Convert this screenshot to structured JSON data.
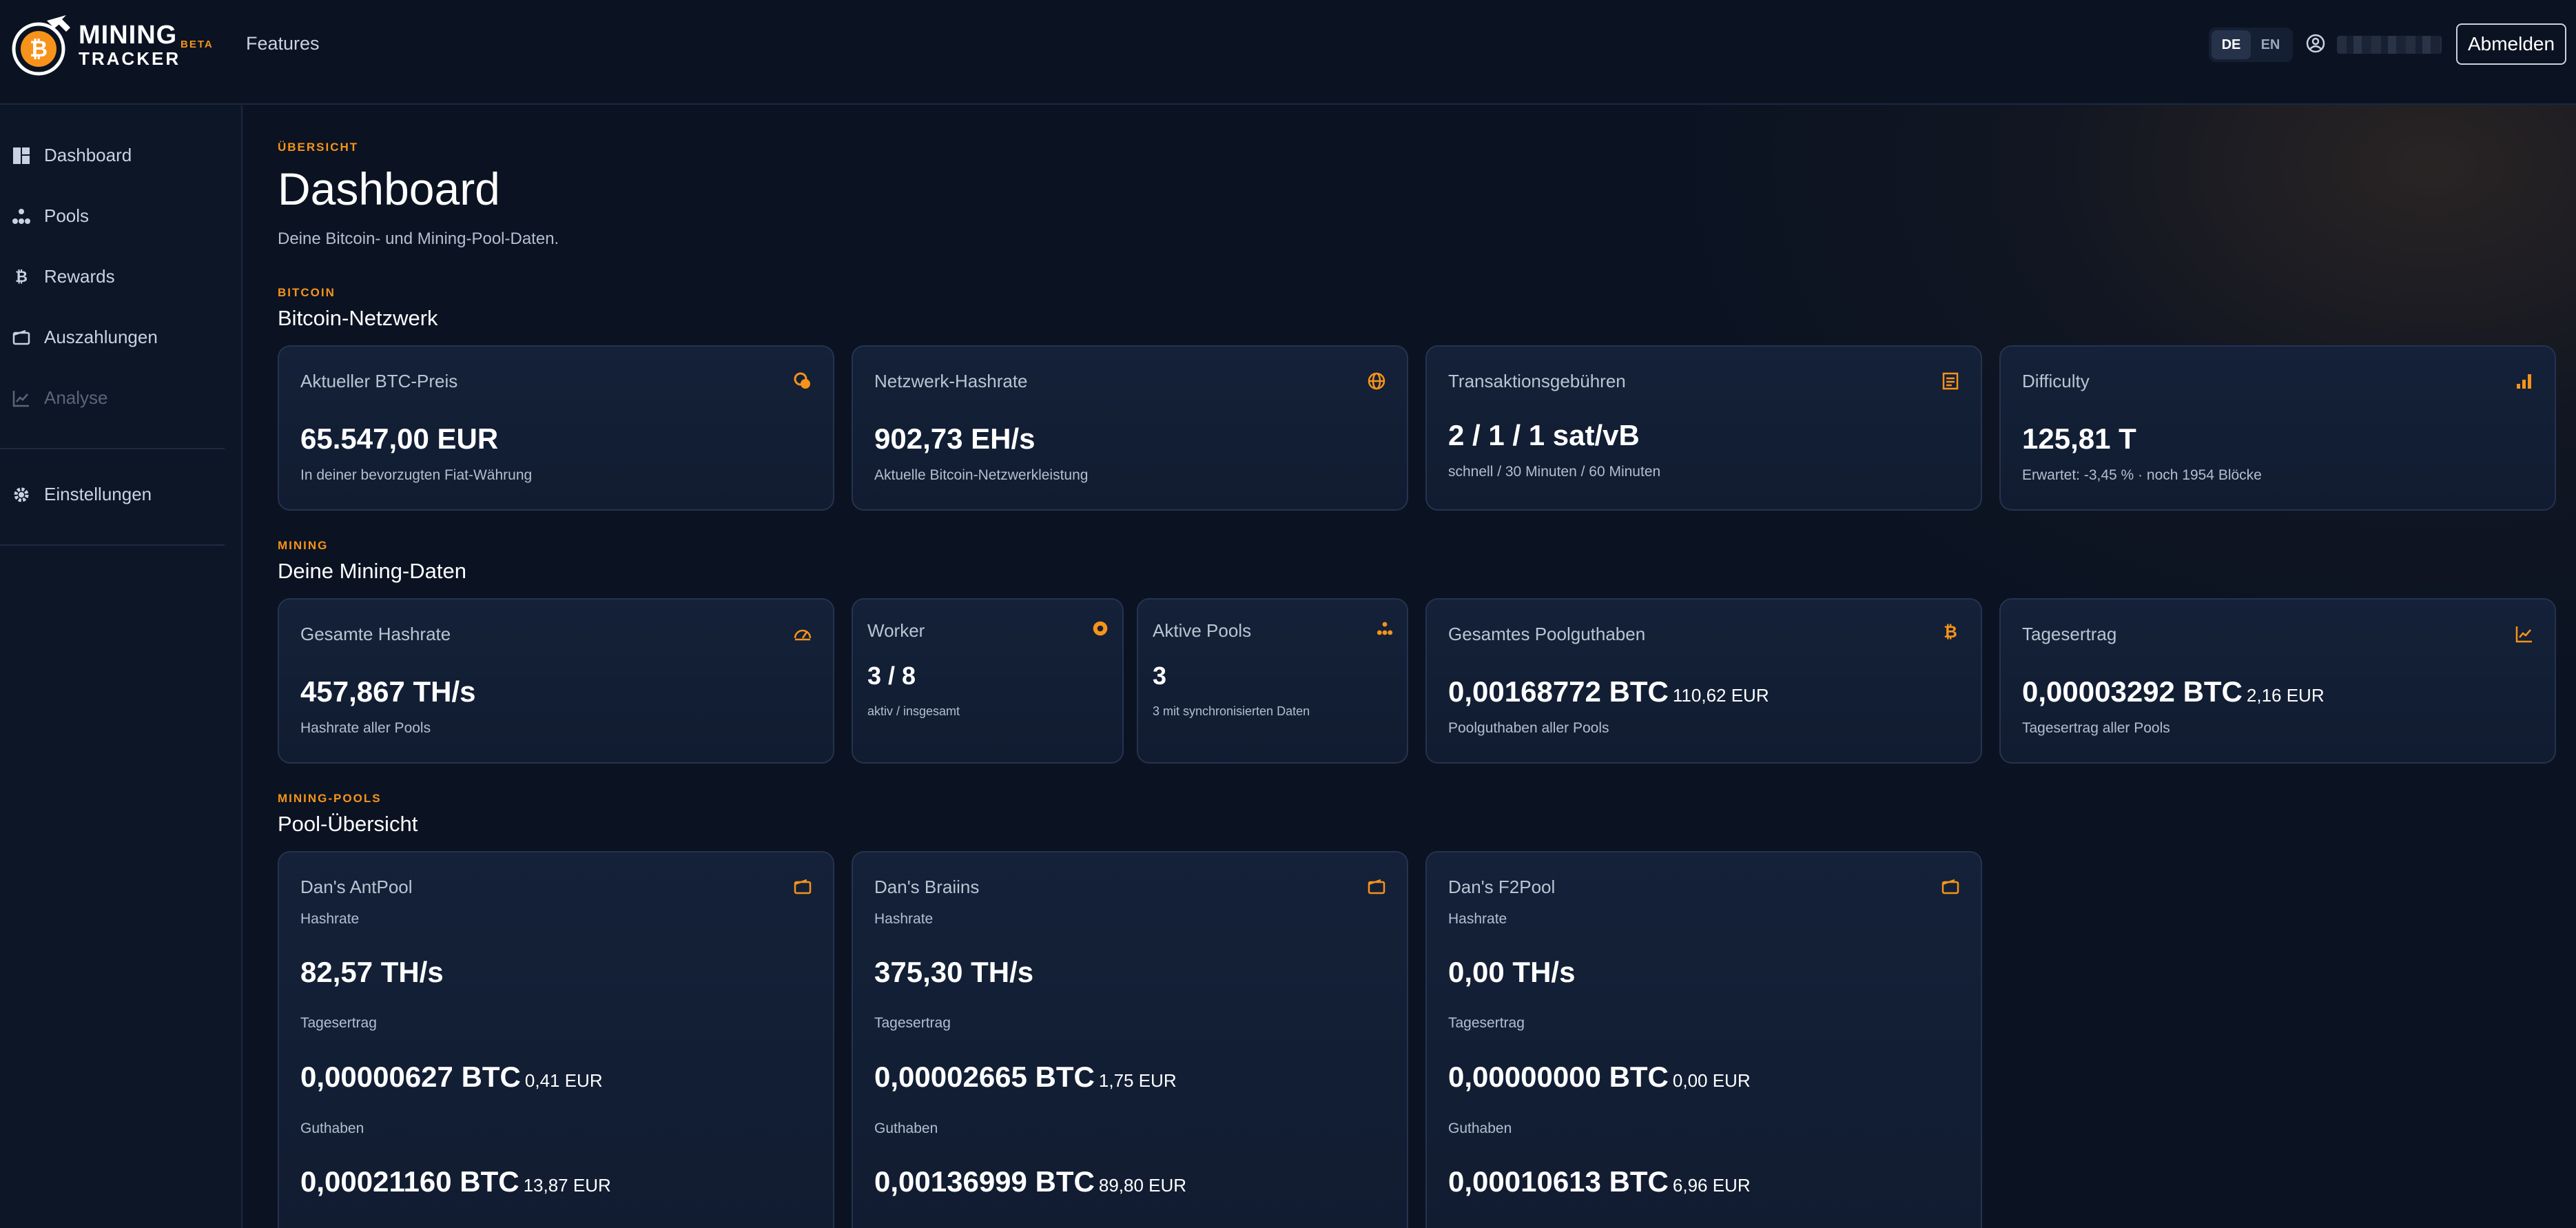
{
  "brand": {
    "line1": "MINING",
    "line2": "TRACKER",
    "beta": "BETA"
  },
  "header": {
    "features": "Features",
    "lang": {
      "de": "DE",
      "en": "EN"
    },
    "logout": "Abmelden"
  },
  "sidebar": {
    "items": [
      {
        "label": "Dashboard",
        "icon": "dashboard-icon"
      },
      {
        "label": "Pools",
        "icon": "pools-icon"
      },
      {
        "label": "Rewards",
        "icon": "bitcoin-icon"
      },
      {
        "label": "Auszahlungen",
        "icon": "wallet-icon"
      },
      {
        "label": "Analyse",
        "icon": "chart-icon"
      },
      {
        "label": "Einstellungen",
        "icon": "gear-icon"
      }
    ]
  },
  "page": {
    "eyebrow": "ÜBERSICHT",
    "title": "Dashboard",
    "subtitle": "Deine Bitcoin- und Mining-Pool-Daten."
  },
  "network": {
    "eyebrow": "BITCOIN",
    "title": "Bitcoin-Netzwerk",
    "cards": [
      {
        "label": "Aktueller BTC-Preis",
        "value": "65.547,00 EUR",
        "note": "In deiner bevorzugten Fiat-Währung"
      },
      {
        "label": "Netzwerk-Hashrate",
        "value": "902,73 EH/s",
        "note": "Aktuelle Bitcoin-Netzwerkleistung"
      },
      {
        "label": "Transaktionsgebühren",
        "value": "2 / 1 / 1 sat/vB",
        "note": "schnell / 30 Minuten / 60 Minuten"
      },
      {
        "label": "Difficulty",
        "value": "125,81 T",
        "note": "Erwartet: -3,45 % · noch 1954 Blöcke"
      }
    ]
  },
  "mining": {
    "eyebrow": "MINING",
    "title": "Deine Mining-Daten",
    "total_hashrate": {
      "label": "Gesamte Hashrate",
      "value": "457,867 TH/s",
      "note": "Hashrate aller Pools"
    },
    "worker": {
      "label": "Worker",
      "value": "3 / 8",
      "note": "aktiv / insgesamt"
    },
    "active_pools": {
      "label": "Aktive Pools",
      "value": "3",
      "note": "3 mit synchronisierten Daten"
    },
    "pool_balance": {
      "label": "Gesamtes Poolguthaben",
      "value": "0,00168772 BTC",
      "sub": "110,62 EUR",
      "note": "Poolguthaben aller Pools"
    },
    "daily_yield": {
      "label": "Tagesertrag",
      "value": "0,00003292 BTC",
      "sub": "2,16 EUR",
      "note": "Tagesertrag aller Pools"
    }
  },
  "pools": {
    "eyebrow": "MINING-POOLS",
    "title": "Pool-Übersicht",
    "hashrate_label": "Hashrate",
    "yield_label": "Tagesertrag",
    "balance_label": "Guthaben",
    "items": [
      {
        "name": "Dan's AntPool",
        "hashrate": "82,57 TH/s",
        "yield": "0,00000627 BTC",
        "yield_eur": "0,41 EUR",
        "balance": "0,00021160 BTC",
        "balance_eur": "13,87 EUR"
      },
      {
        "name": "Dan's Braiins",
        "hashrate": "375,30 TH/s",
        "yield": "0,00002665 BTC",
        "yield_eur": "1,75 EUR",
        "balance": "0,00136999 BTC",
        "balance_eur": "89,80 EUR"
      },
      {
        "name": "Dan's F2Pool",
        "hashrate": "0,00 TH/s",
        "yield": "0,00000000 BTC",
        "yield_eur": "0,00 EUR",
        "balance": "0,00010613 BTC",
        "balance_eur": "6,96 EUR"
      }
    ]
  },
  "colors": {
    "accent": "#f7931a",
    "background": "#0b1322",
    "card": "#131f35",
    "border": "#243350"
  }
}
